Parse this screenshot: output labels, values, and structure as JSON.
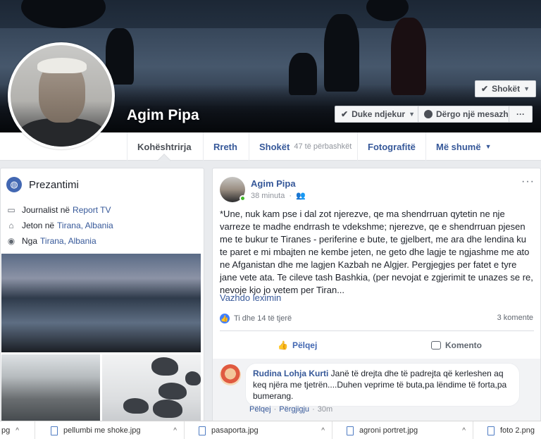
{
  "profile": {
    "name": "Agim Pipa",
    "buttons": {
      "friends": "Shokët",
      "following": "Duke ndjekur",
      "message": "Dërgo një mesazh",
      "more": "···"
    }
  },
  "nav": {
    "timeline": "Kohështrirja",
    "about": "Rreth",
    "friends": "Shokët",
    "friends_mutual": "47 të përbashkët",
    "photos": "Fotografitë",
    "more": "Më shumë"
  },
  "intro": {
    "title": "Prezantimi",
    "job_prefix": "Journalist në",
    "job_place": "Report TV",
    "lives_prefix": "Jeton në",
    "lives_place": "Tirana, Albania",
    "from_prefix": "Nga",
    "from_place": "Tirana, Albania"
  },
  "post": {
    "author": "Agim Pipa",
    "time": "38 minuta",
    "menu": "···",
    "text": "*Une, nuk kam pse i dal zot njerezve, qe ma shendrruan qytetin ne nje varreze te madhe endrrash te vdekshme; njerezve, qe e shendrruan pjesen me te bukur te Tiranes - periferine e bute, te gjelbert, me ara dhe lendina ku te paret e mi mbajten ne kembe jeten, ne geto dhe lagje te ngjashme me ato ne Afganistan dhe me lagjen Kazbah ne Algjer. Pergjegjes per fatet e tyre jane vete ata. Te cileve tash Bashkia, (per nevojat e zgjerimit te unazes se re, nevoje kjo jo vetem per Tiran...",
    "see_more": "Vazhdo leximin",
    "reactions": "Ti dhe 14 të tjerë",
    "comments_count": "3 komente",
    "like_label": "Pëlqej",
    "comment_label": "Komento"
  },
  "comment": {
    "name": "Rudina Lohja Kurti",
    "text": "Janë të drejta dhe të padrejta që kerleshen aq keq njëra me tjetrën....Duhen veprime të buta,pa lëndime të forta,pa bumerang.",
    "like": "Pëlqej",
    "reply": "Përgjigju",
    "time": "30m"
  },
  "downloads": [
    {
      "name": "pg"
    },
    {
      "name": "pellumbi me shoke.jpg"
    },
    {
      "name": "pasaporta.jpg"
    },
    {
      "name": "agroni portret.jpg"
    },
    {
      "name": "foto 2.png"
    }
  ],
  "colors": {
    "link": "#365899",
    "accent": "#4267b2",
    "online": "#42b72a"
  }
}
